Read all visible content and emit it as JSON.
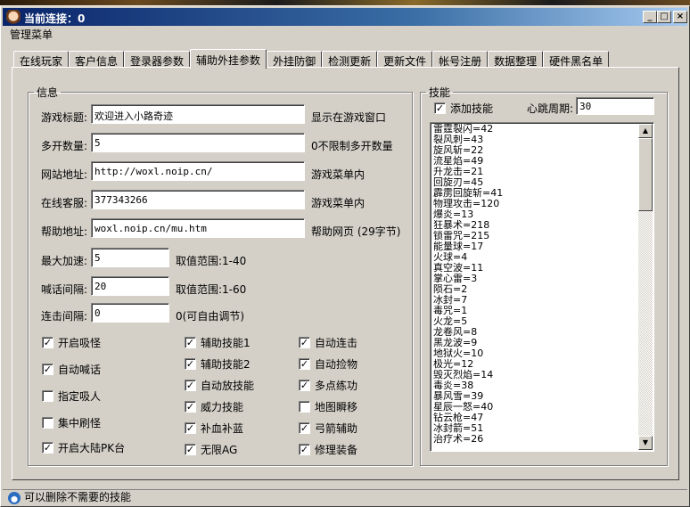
{
  "window": {
    "title": "当前连接：0",
    "controls": [
      "_",
      "□",
      "×"
    ],
    "menu": [
      "管理菜单"
    ]
  },
  "tabs": [
    {
      "label": "在线玩家",
      "active": false
    },
    {
      "label": "客户信息",
      "active": false
    },
    {
      "label": "登录器参数",
      "active": false
    },
    {
      "label": "辅助外挂参数",
      "active": true
    },
    {
      "label": "外挂防御",
      "active": false
    },
    {
      "label": "检测更新",
      "active": false
    },
    {
      "label": "更新文件",
      "active": false
    },
    {
      "label": "帐号注册",
      "active": false
    },
    {
      "label": "数据整理",
      "active": false
    },
    {
      "label": "硬件黑名单",
      "active": false
    }
  ],
  "info": {
    "legend": "信息",
    "game_title": {
      "label": "游戏标题:",
      "value": "欢迎进入小路奇迹",
      "note": "显示在游戏窗口"
    },
    "multi_open": {
      "label": "多开数量:",
      "value": "5",
      "note": "0不限制多开数量"
    },
    "website": {
      "label": "网站地址:",
      "value": "http://woxl.noip.cn/",
      "note": "游戏菜单内"
    },
    "online_service": {
      "label": "在线客服:",
      "value": "377343266",
      "note": "游戏菜单内"
    },
    "help_url": {
      "label": "帮助地址:",
      "value": "woxl.noip.cn/mu.htm",
      "note": "帮助网页 (29字节)"
    },
    "max_speed": {
      "label": "最大加速:",
      "value": "5",
      "note": "取值范围:1-40"
    },
    "shout_interval": {
      "label": "喊话间隔:",
      "value": "20",
      "note": "取值范围:1-60"
    },
    "combo_interval": {
      "label": "连击间隔:",
      "value": "0",
      "note": "0(可自由调节)"
    }
  },
  "options": {
    "col1": [
      {
        "label": "开启吸怪",
        "checked": true
      },
      {
        "label": "自动喊话",
        "checked": true
      },
      {
        "label": "指定吸人",
        "checked": false
      },
      {
        "label": "集中刷怪",
        "checked": false
      },
      {
        "label": "开启大陆PK台",
        "checked": true
      }
    ],
    "col2": [
      {
        "label": "辅助技能1",
        "checked": true
      },
      {
        "label": "辅助技能2",
        "checked": true
      },
      {
        "label": "自动放技能",
        "checked": true
      },
      {
        "label": "威力技能",
        "checked": true
      },
      {
        "label": "补血补蓝",
        "checked": true
      },
      {
        "label": "无限AG",
        "checked": true
      }
    ],
    "col3": [
      {
        "label": "自动连击",
        "checked": true
      },
      {
        "label": "自动捡物",
        "checked": true
      },
      {
        "label": "多点练功",
        "checked": true
      },
      {
        "label": "地图瞬移",
        "checked": false
      },
      {
        "label": "弓箭辅助",
        "checked": true
      },
      {
        "label": "修理装备",
        "checked": true
      }
    ]
  },
  "skills": {
    "legend": "技能",
    "add_skill": {
      "label": "添加技能",
      "checked": true
    },
    "heartbeat": {
      "label": "心跳周期:",
      "value": "30"
    },
    "items": [
      "雷霆裂闪=42",
      "裂风刺=43",
      "旋风斩=22",
      "流星焰=49",
      "升龙击=21",
      "回旋刃=45",
      "霹雳回旋斩=41",
      "物理攻击=120",
      "爆炎=13",
      "狂暴术=218",
      "锁雷咒=215",
      "能量球=17",
      "火球=4",
      "真空波=11",
      "掌心雷=3",
      "陨石=2",
      "冰封=7",
      "毒咒=1",
      "火龙=5",
      "龙卷风=8",
      "黑龙波=9",
      "地狱火=10",
      "极光=12",
      "毁灭烈焰=14",
      "毒炎=38",
      "暴风雪=39",
      "星辰一怒=40",
      "钻云枪=47",
      "冰封箭=51",
      "治疗术=26"
    ],
    "scroll_fraction": 0.22
  },
  "status": {
    "text": "可以删除不需要的技能"
  }
}
